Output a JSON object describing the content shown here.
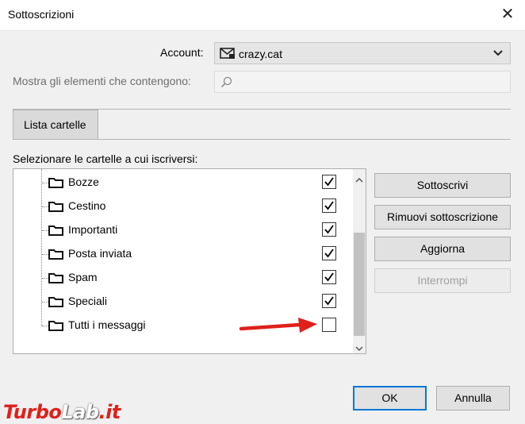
{
  "window": {
    "title": "Sottoscrizioni"
  },
  "account": {
    "label": "Account:",
    "value": "crazy.cat"
  },
  "filter": {
    "label": "Mostra gli elementi che contengono:",
    "value": ""
  },
  "tabs": [
    {
      "label": "Lista cartelle"
    }
  ],
  "list": {
    "heading": "Selezionare le cartelle a cui iscriversi:",
    "folders": [
      {
        "name": "Bozze",
        "subscribed": true
      },
      {
        "name": "Cestino",
        "subscribed": true
      },
      {
        "name": "Importanti",
        "subscribed": true
      },
      {
        "name": "Posta inviata",
        "subscribed": true
      },
      {
        "name": "Spam",
        "subscribed": true
      },
      {
        "name": "Speciali",
        "subscribed": true
      },
      {
        "name": "Tutti i messaggi",
        "subscribed": false
      }
    ]
  },
  "buttons": {
    "subscribe": "Sottoscrivi",
    "unsubscribe": "Rimuovi sottoscrizione",
    "refresh": "Aggiorna",
    "stop": "Interrompi",
    "ok": "OK",
    "cancel": "Annulla"
  },
  "watermark": {
    "part1": "Turbo",
    "part2": "Lab",
    "part3": ".it"
  },
  "colors": {
    "annotation_arrow": "#e0201a",
    "default_button_border": "#0078d7"
  }
}
